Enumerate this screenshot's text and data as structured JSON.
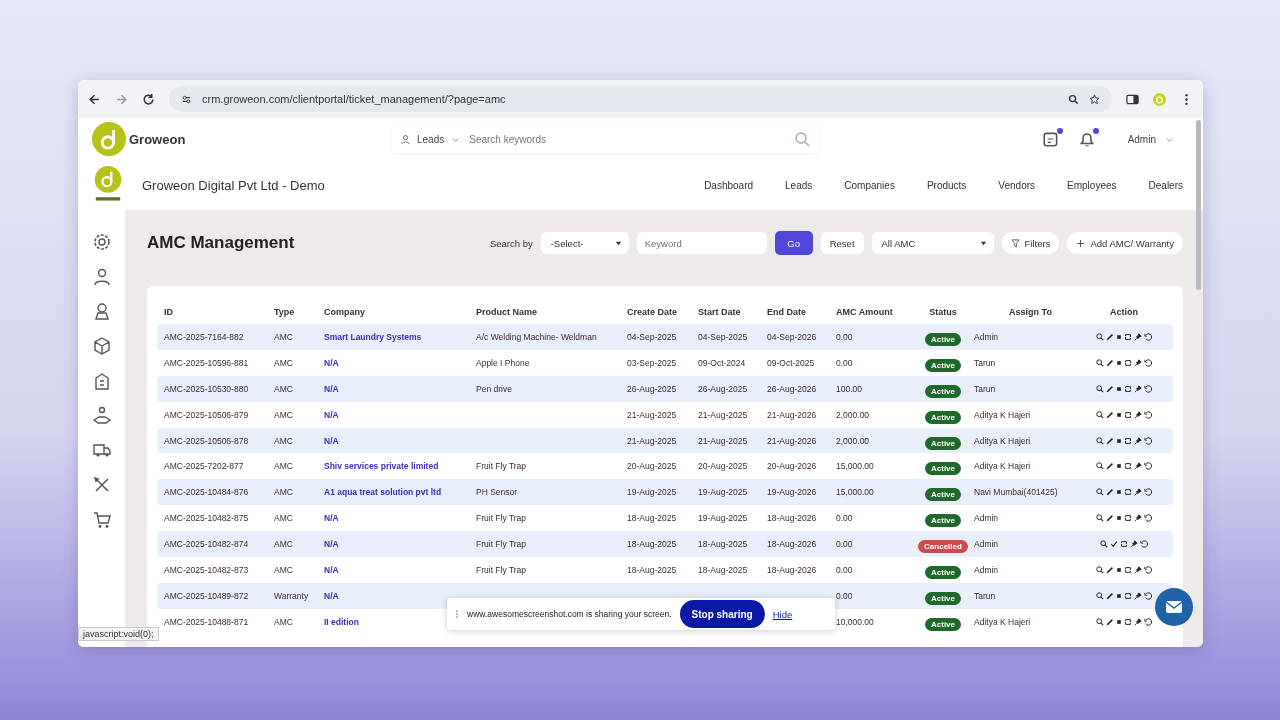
{
  "browser": {
    "url": "crm.groweon.com/clientportal/ticket_management/?page=amc"
  },
  "header": {
    "brand": "Groweon",
    "search_scope": "Leads",
    "search_placeholder": "Search keywords",
    "notifications": [
      {
        "unread": true
      },
      {
        "unread": true
      }
    ],
    "user": "Admin"
  },
  "company_bar": {
    "name": "Groweon Digital Pvt Ltd - Demo",
    "nav": [
      {
        "label": "Dashboard",
        "selected": false
      },
      {
        "label": "Leads",
        "selected": false
      },
      {
        "label": "Companies",
        "selected": false
      },
      {
        "label": "Products",
        "selected": false
      },
      {
        "label": "Vendors",
        "selected": false
      },
      {
        "label": "Employees",
        "selected": false
      },
      {
        "label": "Dealers",
        "selected": false
      }
    ]
  },
  "sidebar": {
    "items": [
      {
        "kind": "gear"
      },
      {
        "kind": "user"
      },
      {
        "kind": "badge"
      },
      {
        "kind": "cube"
      },
      {
        "kind": "building"
      },
      {
        "kind": "hand"
      },
      {
        "kind": "truck"
      },
      {
        "kind": "tools"
      },
      {
        "kind": "cart"
      }
    ]
  },
  "page": {
    "title": "AMC Management",
    "search_by_label": "Search by",
    "search_by_value": "-Select-",
    "keyword_placeholder": "Keyword",
    "go": "Go",
    "reset": "Reset",
    "type_filter": "All AMC",
    "filters": "Filters",
    "add": "Add AMC/ Warranty"
  },
  "table": {
    "columns": [
      "ID",
      "Type",
      "Company",
      "Product Name",
      "Create Date",
      "Start Date",
      "End Date",
      "AMC Amount",
      "Status",
      "Assign To",
      "Action"
    ],
    "rows": [
      {
        "id": "AMC-2025-7164-882",
        "type": "AMC",
        "company": "Smart Laundry Systems",
        "product": "A/c Welding Machine- Weldman",
        "create": "04-Sep-2025",
        "start": "04-Sep-2025",
        "end": "04-Sep-2026",
        "amount": "0.00",
        "status": {
          "label": "Active",
          "kind": "active"
        },
        "assign": "Admin"
      },
      {
        "id": "AMC-2025-10596-881",
        "type": "AMC",
        "company": "N/A",
        "product": "Apple I Phone",
        "create": "03-Sep-2025",
        "start": "09-Oct-2024",
        "end": "09-Oct-2025",
        "amount": "0.00",
        "status": {
          "label": "Active",
          "kind": "active"
        },
        "assign": "Tarun"
      },
      {
        "id": "AMC-2025-10530-880",
        "type": "AMC",
        "company": "N/A",
        "product": "Pen drive",
        "create": "26-Aug-2025",
        "start": "26-Aug-2025",
        "end": "26-Aug-2026",
        "amount": "100.00",
        "status": {
          "label": "Active",
          "kind": "active"
        },
        "assign": "Tarun"
      },
      {
        "id": "AMC-2025-10506-879",
        "type": "AMC",
        "company": "N/A",
        "create": "21-Aug-2025",
        "start": "21-Aug-2025",
        "end": "21-Aug-2026",
        "amount": "2,000.00",
        "status": {
          "label": "Active",
          "kind": "active"
        },
        "assign": "Aditya K Hajeri"
      },
      {
        "id": "AMC-2025-10506-878",
        "type": "AMC",
        "company": "N/A",
        "create": "21-Aug-2025",
        "start": "21-Aug-2025",
        "end": "21-Aug-2026",
        "amount": "2,000.00",
        "status": {
          "label": "Active",
          "kind": "active"
        },
        "assign": "Aditya K Hajeri"
      },
      {
        "id": "AMC-2025-7202-877",
        "type": "AMC",
        "company": "Shiv services private limited",
        "product": "Fruit Fly Trap",
        "create": "20-Aug-2025",
        "start": "20-Aug-2025",
        "end": "20-Aug-2026",
        "amount": "15,000.00",
        "status": {
          "label": "Active",
          "kind": "active"
        },
        "assign": "Aditya K Hajeri"
      },
      {
        "id": "AMC-2025-10484-876",
        "type": "AMC",
        "company": "A1 aqua treat solution pvt ltd",
        "product": "PH Sensor",
        "create": "19-Aug-2025",
        "start": "19-Aug-2025",
        "end": "19-Aug-2026",
        "amount": "15,000.00",
        "status": {
          "label": "Active",
          "kind": "active"
        },
        "assign": "Navi Mumbai(401425)"
      },
      {
        "id": "AMC-2025-10482-875",
        "type": "AMC",
        "company": "N/A",
        "product": "Fruit Fly Trap",
        "create": "18-Aug-2025",
        "start": "19-Aug-2025",
        "end": "18-Aug-2026",
        "amount": "0.00",
        "status": {
          "label": "Active",
          "kind": "active"
        },
        "assign": "Admin"
      },
      {
        "id": "AMC-2025-10482-874",
        "type": "AMC",
        "company": "N/A",
        "product": "Fruit Fly Trap",
        "create": "18-Aug-2025",
        "start": "18-Aug-2025",
        "end": "18-Aug-2026",
        "amount": "0.00",
        "status": {
          "label": "Cancelled",
          "kind": "cancelled"
        },
        "assign": "Admin"
      },
      {
        "id": "AMC-2025-10482-873",
        "type": "AMC",
        "company": "N/A",
        "product": "Fruit Fly Trap",
        "create": "18-Aug-2025",
        "start": "18-Aug-2025",
        "end": "18-Aug-2026",
        "amount": "0.00",
        "status": {
          "label": "Active",
          "kind": "active"
        },
        "assign": "Admin"
      },
      {
        "id": "AMC-2025-10489-872",
        "type": "Warranty",
        "company": "N/A",
        "amount": "0.00",
        "status": {
          "label": "Active",
          "kind": "active"
        },
        "assign": "Tarun"
      },
      {
        "id": "AMC-2025-10488-871",
        "type": "AMC",
        "company": "II edition",
        "amount": "10,000.00",
        "status": {
          "label": "Active",
          "kind": "active"
        },
        "assign": "Aditya K Hajeri"
      }
    ]
  },
  "share_bar": {
    "message": "www.awesomescreenshot.com is sharing your screen.",
    "stop": "Stop sharing",
    "hide": "Hide"
  },
  "status_bar": "javascript:void(0);"
}
